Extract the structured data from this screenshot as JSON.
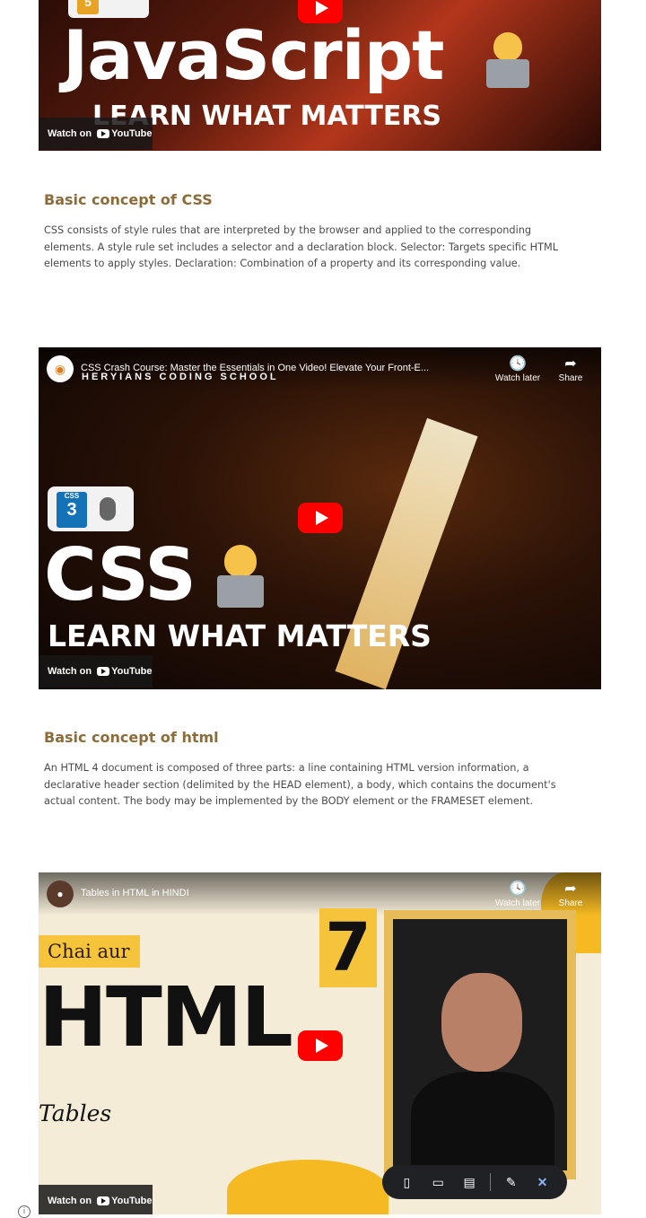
{
  "videos": [
    {
      "big_title": "JavaScript",
      "sub_title": "LEARN WHAT MATTERS",
      "badge": "5",
      "watch_on": "Watch on",
      "youtube": "YouTube"
    },
    {
      "channel_text": "HERYIANS CODING SCHOOL",
      "title": "CSS Crash Course: Master the Essentials in One Video! Elevate Your Front-E...",
      "watch_later": "Watch later",
      "share": "Share",
      "big_title": "CSS",
      "sub_title": "LEARN WHAT MATTERS",
      "badge": "CSS",
      "badge_num": "3",
      "watch_on": "Watch on",
      "youtube": "YouTube"
    },
    {
      "title": "Tables in HTML in HINDI",
      "watch_later": "Watch later",
      "share": "Share",
      "chai": "Chai aur",
      "big_title": "HTML",
      "number": "7",
      "tables": "Tables",
      "watch_on": "Watch on",
      "youtube": "YouTube"
    }
  ],
  "sections": [
    {
      "heading": "Basic concept of CSS",
      "body": "CSS consists of style rules that are interpreted by the browser and applied to the corresponding elements. A style rule set includes a selector and a declaration block. Selector: Targets specific HTML elements to apply styles. Declaration: Combination of a property and its corresponding value."
    },
    {
      "heading": "Basic concept of html",
      "body": "An HTML 4 document is composed of three parts: a line containing HTML version information, a declarative header section (delimited by the HEAD element), a body, which contains the document's actual content. The body may be implemented by the BODY element or the FRAMESET element."
    }
  ],
  "icons": {
    "clock": "clock-icon",
    "share": "share-icon",
    "phone": "phone-icon",
    "tablet": "tablet-icon",
    "laptop": "laptop-icon",
    "feedback": "feedback-icon",
    "close": "close-icon",
    "info": "info-icon"
  },
  "colors": {
    "heading": "#8a6d3b",
    "youtube_red": "#ff0000",
    "toolbar_bg": "#202124",
    "close_accent": "#8ab4f8"
  }
}
